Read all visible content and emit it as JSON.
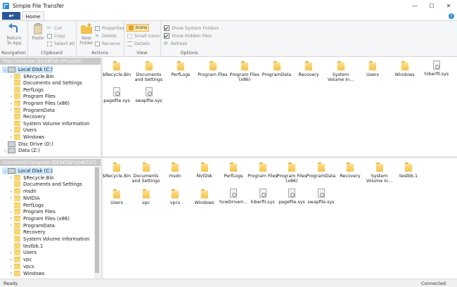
{
  "window": {
    "title": "Simple File Transfer",
    "minimize": "—",
    "maximize": "☐",
    "close": "✕"
  },
  "ribbon_tabs": {
    "file": "▪▾",
    "home": "Home",
    "help": "?"
  },
  "ribbon": {
    "navigation": {
      "label": "Navigation",
      "return_line1": "Return",
      "return_line2": "To App"
    },
    "clipboard": {
      "label": "Clipboard",
      "paste": "Paste",
      "cut": "Cut",
      "copy": "Copy",
      "select_all": "Select All"
    },
    "actions": {
      "label": "Actions",
      "new_folder_line1": "New",
      "new_folder_line2": "Folder",
      "properties": "Properties",
      "delete": "Delete",
      "rename": "Rename"
    },
    "view": {
      "label": "View",
      "icons": "Icons",
      "small_icons": "Small Icons",
      "details": "Details"
    },
    "options": {
      "label": "Options",
      "show_system": "Show System Folders",
      "show_hidden": "Show Hidden Files",
      "refresh": "Refresh"
    }
  },
  "this_computer": {
    "header": "This Computer (DESKTOP-EP1U2DF)",
    "tree": [
      {
        "label": "Local Disk (C:)",
        "level": 0,
        "type": "drive",
        "chev": "⌄",
        "selected": true
      },
      {
        "label": "$Recycle.Bin",
        "level": 1,
        "type": "folder",
        "chev": "›"
      },
      {
        "label": "Documents and Settings",
        "level": 1,
        "type": "folder",
        "chev": ""
      },
      {
        "label": "PerfLogs",
        "level": 1,
        "type": "folder",
        "chev": ""
      },
      {
        "label": "Program Files",
        "level": 1,
        "type": "folder",
        "chev": "›"
      },
      {
        "label": "Program Files (x86)",
        "level": 1,
        "type": "folder",
        "chev": "›"
      },
      {
        "label": "ProgramData",
        "level": 1,
        "type": "folder",
        "chev": "›"
      },
      {
        "label": "Recovery",
        "level": 1,
        "type": "folder",
        "chev": ""
      },
      {
        "label": "System Volume Information",
        "level": 1,
        "type": "folder",
        "chev": ""
      },
      {
        "label": "Users",
        "level": 1,
        "type": "folder",
        "chev": "›"
      },
      {
        "label": "Windows",
        "level": 1,
        "type": "folder",
        "chev": "›"
      },
      {
        "label": "Disc Drive (D:)",
        "level": 0,
        "type": "drive",
        "chev": ""
      },
      {
        "label": "Data (Z:)",
        "level": 0,
        "type": "drive",
        "chev": "›"
      }
    ],
    "files": [
      {
        "name": "$Recycle.Bin",
        "type": "folder"
      },
      {
        "name": "Documents and Settings",
        "type": "folder"
      },
      {
        "name": "PerfLogs",
        "type": "folder"
      },
      {
        "name": "Program Files",
        "type": "folder"
      },
      {
        "name": "Program Files (x86)",
        "type": "folder"
      },
      {
        "name": "ProgramData",
        "type": "folder"
      },
      {
        "name": "Recovery",
        "type": "folder"
      },
      {
        "name": "System Volume In...",
        "type": "folder"
      },
      {
        "name": "Users",
        "type": "folder"
      },
      {
        "name": "Windows",
        "type": "folder"
      },
      {
        "name": "hiberfil.sys",
        "type": "file"
      },
      {
        "name": "pagefile.sys",
        "type": "file"
      },
      {
        "name": "swapfile.sys",
        "type": "file"
      }
    ]
  },
  "connected_computer": {
    "header": "Connected Computer (DESKTOP-V04ET2T)",
    "tree": [
      {
        "label": "Local Disk (C:)",
        "level": 0,
        "type": "drive",
        "chev": "⌄",
        "selected": true
      },
      {
        "label": "$Recycle.Bin",
        "level": 1,
        "type": "folder",
        "chev": "›"
      },
      {
        "label": "Documents and Settings",
        "level": 1,
        "type": "folder",
        "chev": ""
      },
      {
        "label": "msdn",
        "level": 1,
        "type": "folder",
        "chev": "›"
      },
      {
        "label": "NVIDIA",
        "level": 1,
        "type": "folder",
        "chev": "›"
      },
      {
        "label": "PerfLogs",
        "level": 1,
        "type": "folder",
        "chev": ""
      },
      {
        "label": "Program Files",
        "level": 1,
        "type": "folder",
        "chev": "›"
      },
      {
        "label": "Program Files (x86)",
        "level": 1,
        "type": "folder",
        "chev": "›"
      },
      {
        "label": "ProgramData",
        "level": 1,
        "type": "folder",
        "chev": "›"
      },
      {
        "label": "Recovery",
        "level": 1,
        "type": "folder",
        "chev": ""
      },
      {
        "label": "System Volume Information",
        "level": 1,
        "type": "folder",
        "chev": ""
      },
      {
        "label": "testbb.1",
        "level": 1,
        "type": "folder",
        "chev": ""
      },
      {
        "label": "Users",
        "level": 1,
        "type": "folder",
        "chev": "›"
      },
      {
        "label": "vpc",
        "level": 1,
        "type": "folder",
        "chev": "›"
      },
      {
        "label": "vpcs",
        "level": 1,
        "type": "folder",
        "chev": "›"
      },
      {
        "label": "Windows",
        "level": 1,
        "type": "folder",
        "chev": "›"
      }
    ],
    "files": [
      {
        "name": "$Recycle.Bin",
        "type": "folder"
      },
      {
        "name": "Documents and Settings",
        "type": "folder"
      },
      {
        "name": "msdn",
        "type": "folder"
      },
      {
        "name": "NVIDIA",
        "type": "folder"
      },
      {
        "name": "PerfLogs",
        "type": "folder"
      },
      {
        "name": "Program Files",
        "type": "folder"
      },
      {
        "name": "Program Files (x86)",
        "type": "folder"
      },
      {
        "name": "ProgramData",
        "type": "folder"
      },
      {
        "name": "Recovery",
        "type": "folder"
      },
      {
        "name": "System Volume In...",
        "type": "folder"
      },
      {
        "name": "testbb.1",
        "type": "folder"
      },
      {
        "name": "Users",
        "type": "folder"
      },
      {
        "name": "vpc",
        "type": "folder"
      },
      {
        "name": "vpcs",
        "type": "folder"
      },
      {
        "name": "Windows",
        "type": "folder"
      },
      {
        "name": "hcwDriverI...",
        "type": "file"
      },
      {
        "name": "hiberfil.sys",
        "type": "file"
      },
      {
        "name": "pagefile.sys",
        "type": "file"
      },
      {
        "name": "swapfile.sys",
        "type": "file"
      }
    ]
  },
  "status": {
    "left": "Ready",
    "right": "Connected"
  },
  "colors": {
    "accent": "#2b579a",
    "selection": "#cde8ff",
    "folder": "#f8d775",
    "pane_header": "#c9c9c9"
  }
}
